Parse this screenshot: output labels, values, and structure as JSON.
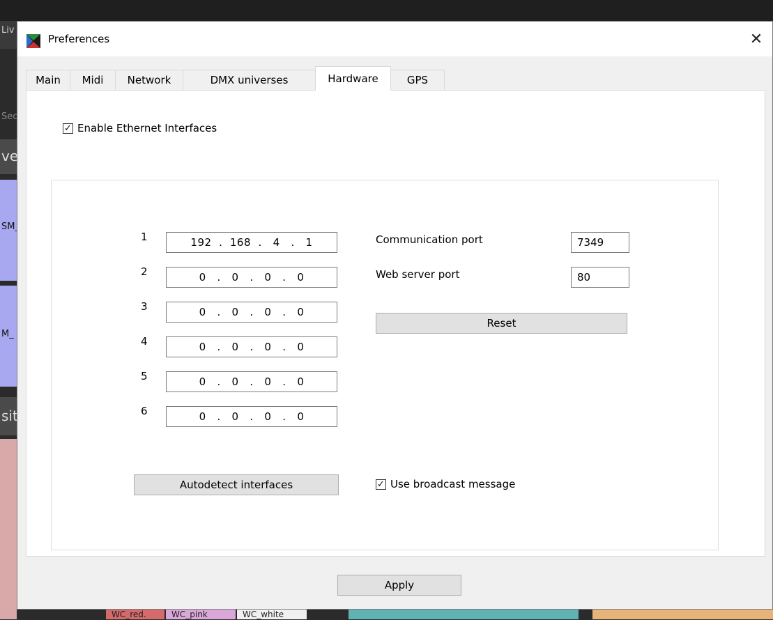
{
  "background": {
    "tab_label": "Liv",
    "sec_label": "Sec",
    "ve_label": "ve",
    "sm_label": "SM_",
    "m_label": "M_",
    "sit_label": "sit",
    "wc_red": "WC_red.",
    "wc_pink": "WC_pink",
    "wc_white": "WC_white"
  },
  "dialog": {
    "title": "Preferences",
    "close_glyph": "✕",
    "icon": "preferences-app-icon",
    "tabs": [
      {
        "label": "Main"
      },
      {
        "label": "Midi"
      },
      {
        "label": "Network"
      },
      {
        "label": "DMX universes"
      },
      {
        "label": "Hardware"
      },
      {
        "label": "GPS"
      }
    ],
    "active_tab": "Hardware",
    "hardware": {
      "enable_ethernet": {
        "label": "Enable Ethernet Interfaces",
        "checked_glyph": "✓"
      },
      "interfaces": [
        {
          "num": "1",
          "ip": "192  .  168  .   4   .   1"
        },
        {
          "num": "2",
          "ip": "0   .   0   .   0   .   0"
        },
        {
          "num": "3",
          "ip": "0   .   0   .   0   .   0"
        },
        {
          "num": "4",
          "ip": "0   .   0   .   0   .   0"
        },
        {
          "num": "5",
          "ip": "0   .   0   .   0   .   0"
        },
        {
          "num": "6",
          "ip": "0   .   0   .   0   .   0"
        }
      ],
      "communication_port": {
        "label": "Communication port",
        "value": "7349"
      },
      "web_server_port": {
        "label": "Web server port",
        "value": "80"
      },
      "reset_label": "Reset",
      "autodetect_label": "Autodetect interfaces",
      "broadcast": {
        "label": "Use broadcast message",
        "checked_glyph": "✓"
      }
    },
    "apply_label": "Apply"
  }
}
